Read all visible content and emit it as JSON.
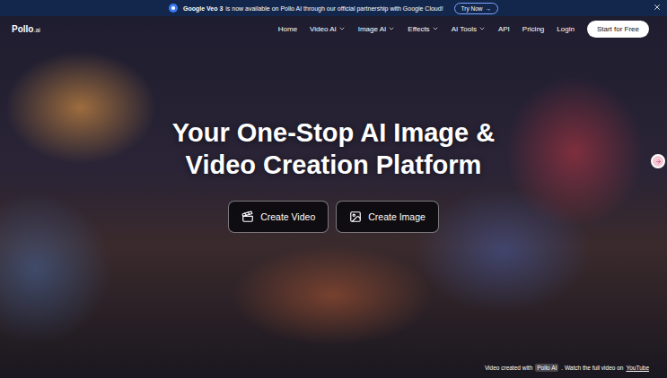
{
  "banner": {
    "highlight": "Google Veo 3",
    "text": "is now available on Pollo AI through our official partnership with Google Cloud!",
    "button": "Try Now",
    "button_arrow": "→"
  },
  "logo": {
    "name": "Pollo",
    "suffix": ".ai"
  },
  "nav": {
    "items": [
      {
        "label": "Home",
        "dropdown": false
      },
      {
        "label": "Video AI",
        "dropdown": true
      },
      {
        "label": "Image AI",
        "dropdown": true
      },
      {
        "label": "Effects",
        "dropdown": true
      },
      {
        "label": "AI Tools",
        "dropdown": true
      },
      {
        "label": "API",
        "dropdown": false
      },
      {
        "label": "Pricing",
        "dropdown": false
      },
      {
        "label": "Login",
        "dropdown": false
      }
    ],
    "cta": "Start for Free"
  },
  "hero": {
    "title_lines": [
      "Your One-Stop AI Image &",
      "Video Creation Platform"
    ],
    "buttons": [
      {
        "label": "Create Video",
        "kind": "video"
      },
      {
        "label": "Create Image",
        "kind": "image"
      }
    ]
  },
  "caption": {
    "prefix": "Video created with",
    "brand": "Pollo AI",
    "middle": ". Watch the full video on",
    "link": "YouTube"
  }
}
